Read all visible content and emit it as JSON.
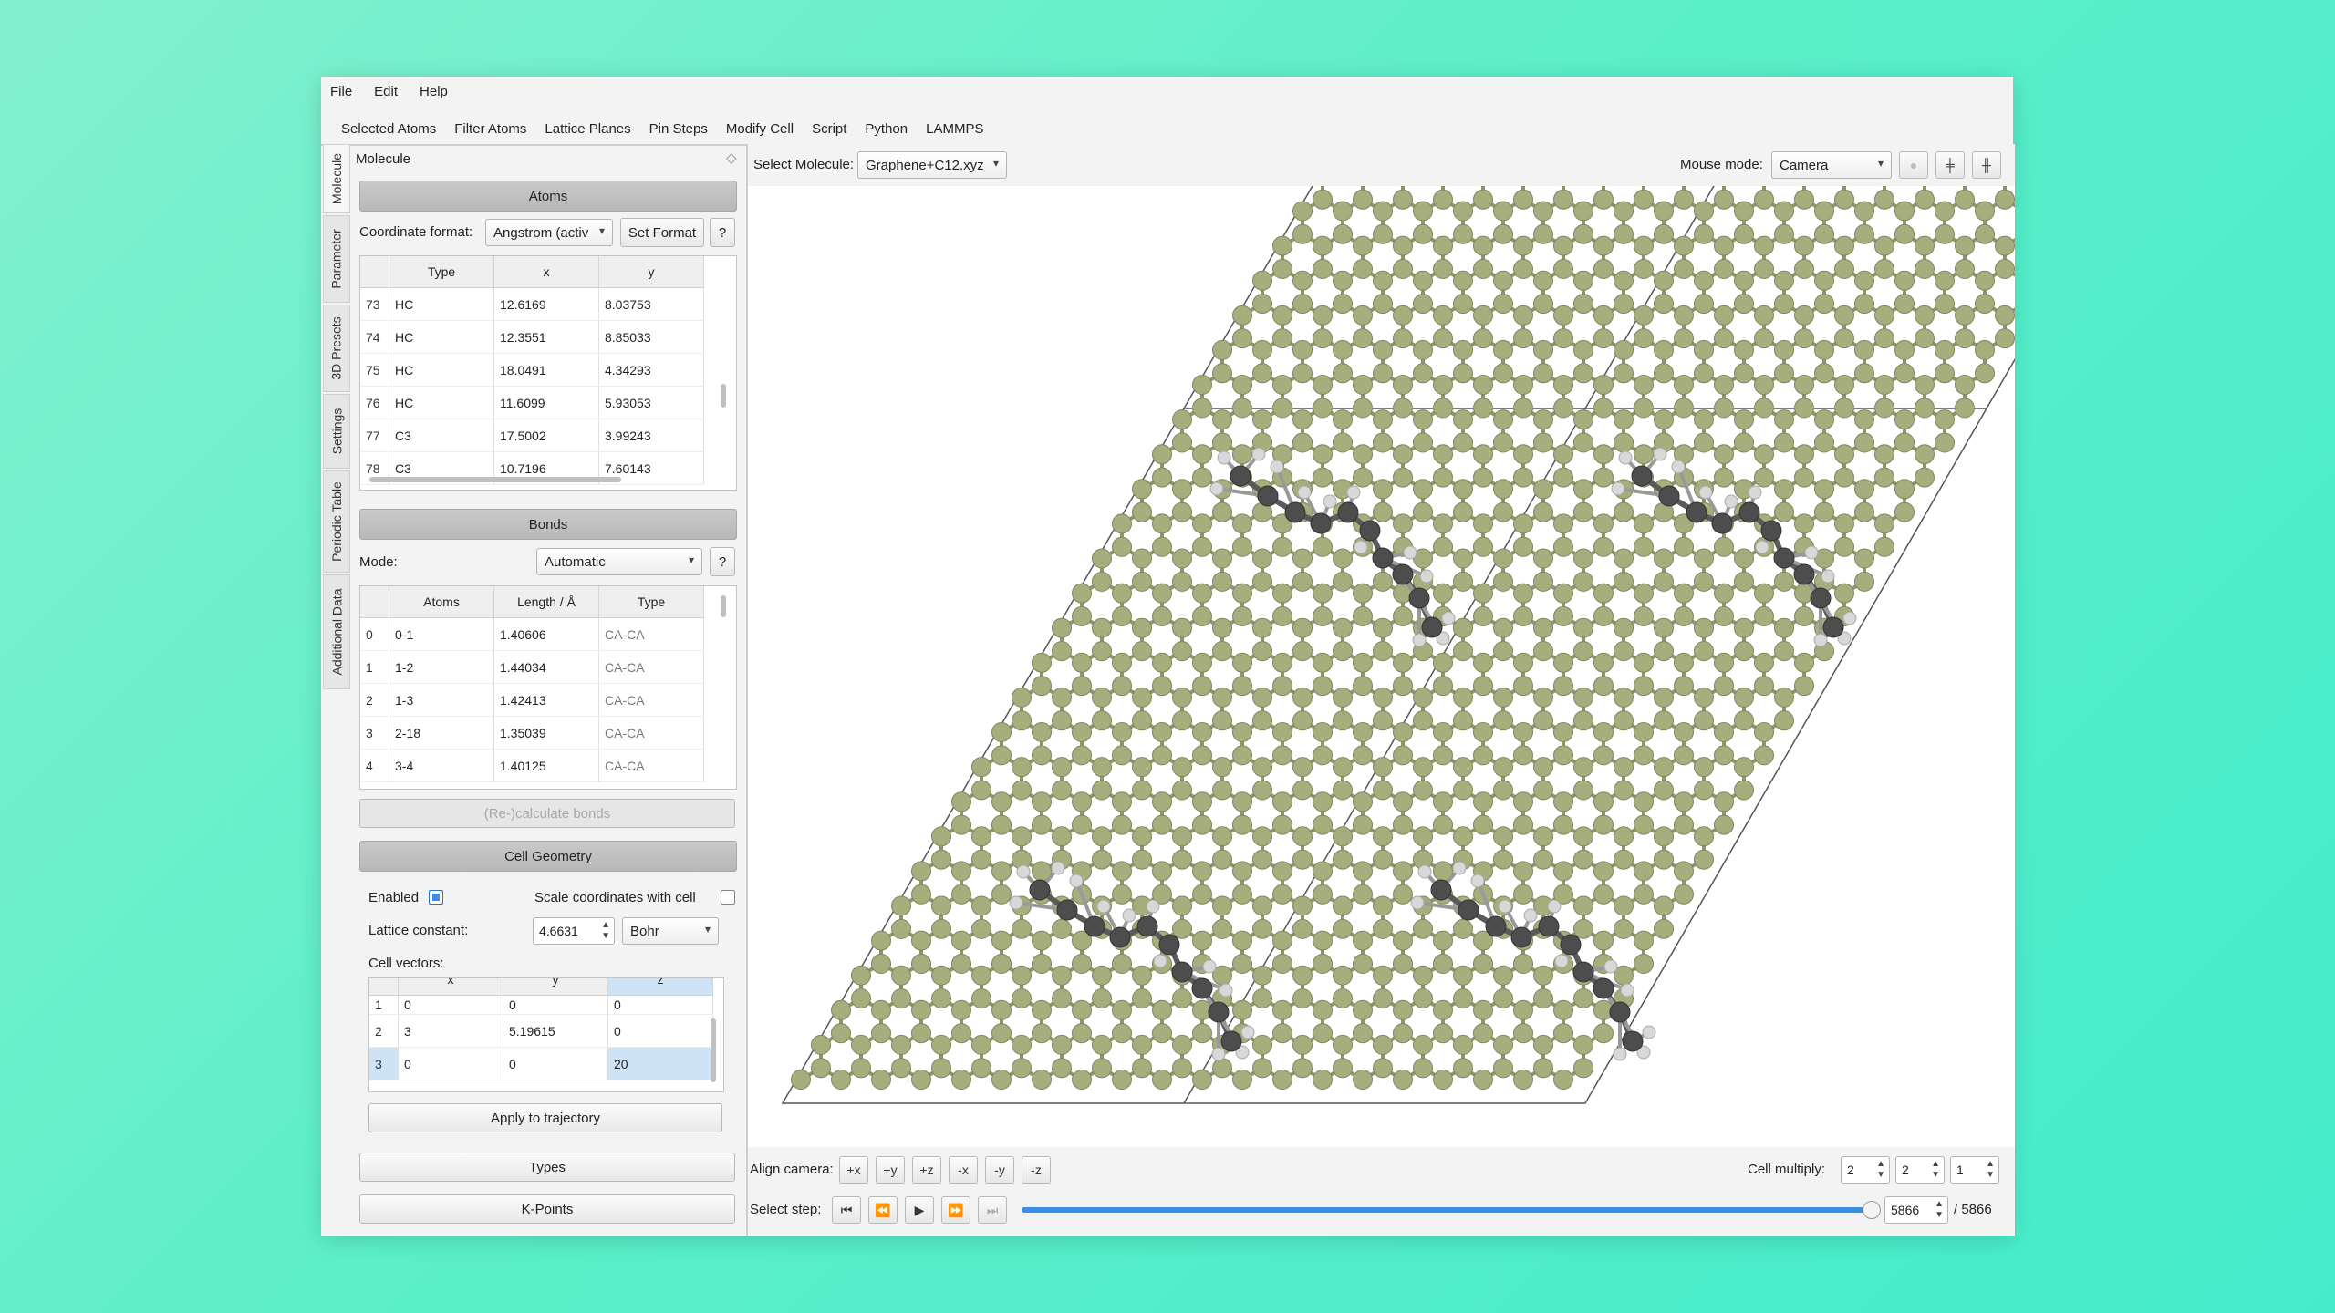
{
  "menu": [
    "File",
    "Edit",
    "Help"
  ],
  "toolbar": [
    "Selected Atoms",
    "Filter Atoms",
    "Lattice Planes",
    "Pin Steps",
    "Modify Cell",
    "Script",
    "Python",
    "LAMMPS"
  ],
  "side_tabs": [
    "Molecule",
    "Parameter",
    "3D Presets",
    "Settings",
    "Periodic Table",
    "Additional Data"
  ],
  "panel": {
    "title": "Molecule",
    "atoms_header": "Atoms",
    "coord_format_label": "Coordinate format:",
    "coord_format_value": "Angstrom (activ",
    "set_format": "Set Format",
    "help": "?",
    "atoms_columns": [
      "Type",
      "x",
      "y"
    ],
    "atoms_rows": [
      {
        "i": "73",
        "type": "HC",
        "x": "12.6169",
        "y": "8.03753"
      },
      {
        "i": "74",
        "type": "HC",
        "x": "12.3551",
        "y": "8.85033"
      },
      {
        "i": "75",
        "type": "HC",
        "x": "18.0491",
        "y": "4.34293"
      },
      {
        "i": "76",
        "type": "HC",
        "x": "11.6099",
        "y": "5.93053"
      },
      {
        "i": "77",
        "type": "C3",
        "x": "17.5002",
        "y": "3.99243"
      },
      {
        "i": "78",
        "type": "C3",
        "x": "10.7196",
        "y": "7.60143"
      }
    ],
    "bonds_header": "Bonds",
    "mode_label": "Mode:",
    "mode_value": "Automatic",
    "bonds_columns": [
      "Atoms",
      "Length / Å",
      "Type"
    ],
    "bonds_rows": [
      {
        "i": "0",
        "atoms": "0-1",
        "length": "1.40606",
        "type": "CA-CA"
      },
      {
        "i": "1",
        "atoms": "1-2",
        "length": "1.44034",
        "type": "CA-CA"
      },
      {
        "i": "2",
        "atoms": "1-3",
        "length": "1.42413",
        "type": "CA-CA"
      },
      {
        "i": "3",
        "atoms": "2-18",
        "length": "1.35039",
        "type": "CA-CA"
      },
      {
        "i": "4",
        "atoms": "3-4",
        "length": "1.40125",
        "type": "CA-CA"
      }
    ],
    "recalc_bonds": "(Re-)calculate bonds",
    "cell_header": "Cell Geometry",
    "enabled_label": "Enabled",
    "scale_label": "Scale coordinates with cell",
    "lattice_label": "Lattice constant:",
    "lattice_value": "4.6631",
    "lattice_unit": "Bohr",
    "cell_vectors_label": "Cell vectors:",
    "cell_columns": [
      "x",
      "y",
      "z"
    ],
    "cell_rows": [
      {
        "i": "1",
        "x": "0",
        "y": "0",
        "z": "0"
      },
      {
        "i": "2",
        "x": "3",
        "y": "5.19615",
        "z": "0"
      },
      {
        "i": "3",
        "x": "0",
        "y": "0",
        "z": "20"
      }
    ],
    "apply_traj": "Apply to trajectory",
    "types": "Types",
    "kpoints": "K-Points"
  },
  "viewer": {
    "select_molecule_label": "Select Molecule:",
    "select_molecule_value": "Graphene+C12.xyz",
    "mouse_mode_label": "Mouse mode:",
    "mouse_mode_value": "Camera",
    "align_label": "Align camera:",
    "align_buttons": [
      "+x",
      "+y",
      "+z",
      "-x",
      "-y",
      "-z"
    ],
    "cell_multiply_label": "Cell multiply:",
    "mult": [
      "2",
      "2",
      "1"
    ],
    "select_step_label": "Select step:",
    "step_value": "5866",
    "step_total": "/ 5866",
    "slider_fraction": 1.0
  },
  "colors": {
    "graphene": "#a7ae7e",
    "carbon": "#4d4d4d",
    "hydrogen": "#d8d8d8",
    "accent": "#3a8ee6"
  }
}
